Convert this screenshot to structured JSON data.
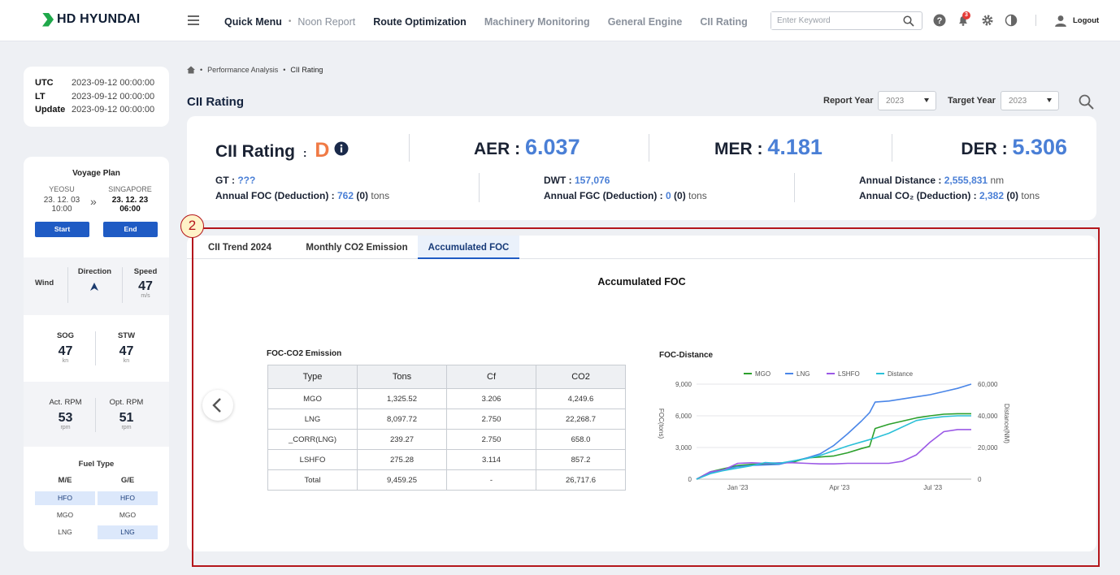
{
  "brand": {
    "name": "HD HYUNDAI",
    "accent": "#1fa84a"
  },
  "nav": {
    "quick_menu": "Quick Menu",
    "items": [
      "Noon Report",
      "Route Optimization",
      "Machinery Monitoring",
      "General Engine",
      "CII Rating"
    ],
    "more": "»"
  },
  "search": {
    "placeholder": "Enter Keyword"
  },
  "header": {
    "notifications": "3",
    "logout": "Logout"
  },
  "times": [
    {
      "k": "UTC",
      "v": "2023-09-12 00:00:00"
    },
    {
      "k": "LT",
      "v": "2023-09-12 00:00:00"
    },
    {
      "k": "Update",
      "v": "2023-09-12 00:00:00"
    }
  ],
  "voyage": {
    "title": "Voyage Plan",
    "from": {
      "port": "YEOSU",
      "date": "23. 12. 03",
      "time": "10:00"
    },
    "to": {
      "port": "SINGAPORE",
      "date": "23. 12. 23",
      "time": "06:00"
    },
    "start": "Start",
    "end": "End"
  },
  "wind": {
    "label": "Wind",
    "direction": "Direction",
    "speed_label": "Speed",
    "speed": "47",
    "unit": "m/s"
  },
  "sog": {
    "label": "SOG",
    "value": "47",
    "unit": "kn"
  },
  "stw": {
    "label": "STW",
    "value": "47",
    "unit": "kn"
  },
  "act_rpm": {
    "label": "Act. RPM",
    "value": "53",
    "unit": "rpm"
  },
  "opt_rpm": {
    "label": "Opt. RPM",
    "value": "51",
    "unit": "rpm"
  },
  "fuel": {
    "title": "Fuel Type",
    "me": "M/E",
    "ge": "G/E",
    "me_items": [
      "HFO",
      "MGO",
      "LNG"
    ],
    "ge_items": [
      "HFO",
      "MGO",
      "LNG"
    ]
  },
  "breadcrumb": {
    "section": "Performance Analysis",
    "page": "CII Rating"
  },
  "page": {
    "title": "CII Rating",
    "report_year_label": "Report Year",
    "report_year": "2023",
    "target_year_label": "Target Year",
    "target_year": "2023"
  },
  "summary": {
    "cii_label": "CII Rating",
    "cii_grade": "D",
    "aer_label": "AER",
    "aer": "6.037",
    "mer_label": "MER",
    "mer": "4.181",
    "der_label": "DER",
    "der": "5.306",
    "gt_label": "GT :",
    "gt": "???",
    "foc_label": "Annual FOC (Deduction) :",
    "foc": "762",
    "foc_ded": "(0)",
    "foc_unit": "tons",
    "dwt_label": "DWT :",
    "dwt": "157,076",
    "fgc_label": "Annual FGC (Deduction) :",
    "fgc": "0",
    "fgc_ded": "(0)",
    "fgc_unit": "tons",
    "dist_label": "Annual Distance :",
    "dist": "2,555,831",
    "dist_unit": "nm",
    "co2_label": "Annual CO₂ (Deduction) :",
    "co2": "2,382",
    "co2_ded": "(0)",
    "co2_unit": "tons"
  },
  "tabs": [
    "CII Trend 2024",
    "Monthly CO2 Emission",
    "Accumulated FOC"
  ],
  "panel_title": "Accumulated FOC",
  "table": {
    "title": "FOC-CO2 Emission",
    "headers": [
      "Type",
      "Tons",
      "Cf",
      "CO2"
    ],
    "rows": [
      [
        "MGO",
        "1,325.52",
        "3.206",
        "4,249.6"
      ],
      [
        "LNG",
        "8,097.72",
        "2.750",
        "22,268.7"
      ],
      [
        "_CORR(LNG)",
        "239.27",
        "2.750",
        "658.0"
      ],
      [
        "LSHFO",
        "275.28",
        "3.114",
        "857.2"
      ],
      [
        "Total",
        "9,459.25",
        "-",
        "26,717.6"
      ]
    ]
  },
  "annotation": {
    "number": "2"
  },
  "chart_data": {
    "type": "line",
    "title": "FOC-Distance",
    "ylabel": "FOC(tons)",
    "y2label": "Distance(NM)",
    "ylim": [
      0,
      9000
    ],
    "y2lim": [
      0,
      60000
    ],
    "yticks": [
      "0",
      "3,000",
      "6,000",
      "9,000"
    ],
    "y2ticks": [
      "0",
      "20,000",
      "40,000",
      "60,000"
    ],
    "xticks": [
      {
        "label": "Jan '23",
        "t": 0.15
      },
      {
        "label": "Apr '23",
        "t": 0.52
      },
      {
        "label": "Jul '23",
        "t": 0.86
      }
    ],
    "t": [
      0,
      0.05,
      0.1,
      0.15,
      0.2,
      0.25,
      0.3,
      0.35,
      0.4,
      0.45,
      0.5,
      0.55,
      0.6,
      0.63,
      0.65,
      0.7,
      0.75,
      0.8,
      0.85,
      0.9,
      0.95,
      1.0
    ],
    "series": [
      {
        "name": "MGO",
        "color": "#2ca02c",
        "axis": "left",
        "values": [
          0,
          700,
          1000,
          1300,
          1400,
          1450,
          1500,
          1600,
          2000,
          2100,
          2200,
          2500,
          2900,
          3100,
          4800,
          5200,
          5500,
          5800,
          6000,
          6150,
          6200,
          6200
        ]
      },
      {
        "name": "LNG",
        "color": "#4a86e8",
        "axis": "left",
        "values": [
          0,
          600,
          900,
          1200,
          1300,
          1350,
          1400,
          1700,
          2000,
          2400,
          3200,
          4300,
          5500,
          6300,
          7300,
          7400,
          7600,
          7800,
          8000,
          8300,
          8600,
          9000
        ]
      },
      {
        "name": "LSHFO",
        "color": "#9b59e6",
        "axis": "left",
        "values": [
          0,
          700,
          900,
          1500,
          1550,
          1500,
          1550,
          1550,
          1500,
          1450,
          1450,
          1500,
          1500,
          1500,
          1500,
          1500,
          1700,
          2300,
          3500,
          4500,
          4700,
          4700
        ]
      },
      {
        "name": "Distance",
        "color": "#2bc0d8",
        "axis": "right",
        "values": [
          0,
          3500,
          5500,
          7000,
          8500,
          10500,
          10000,
          11500,
          13000,
          15000,
          18000,
          21000,
          23500,
          25000,
          26000,
          29000,
          33000,
          37000,
          38500,
          39500,
          40000,
          40000
        ]
      }
    ]
  }
}
